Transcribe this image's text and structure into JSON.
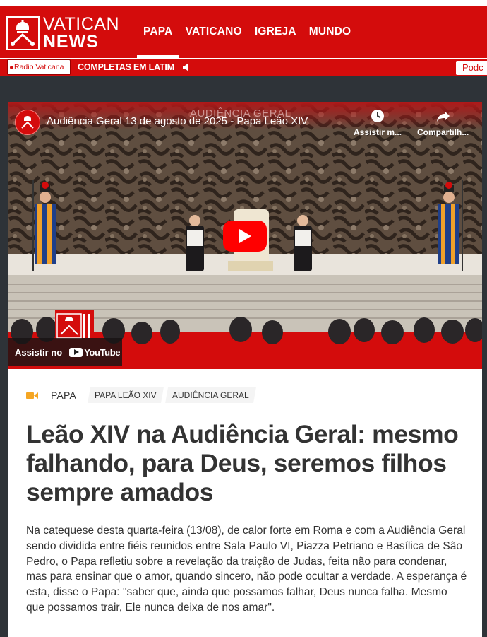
{
  "site": {
    "logo_line1": "VATICAN",
    "logo_line2": "NEWS"
  },
  "nav": {
    "items": [
      {
        "label": "PAPA",
        "active": true
      },
      {
        "label": "VATICANO"
      },
      {
        "label": "IGREJA"
      },
      {
        "label": "MUNDO"
      }
    ]
  },
  "radio": {
    "badge": "Radio Vaticana",
    "program": "COMPLETAS EM LATIM",
    "podcast_label": "Podc"
  },
  "video": {
    "title": "Audiência Geral 13 de agosto de 2025 - Papa Leão XIV",
    "watermark": "AUDIÊNCIA GERAL",
    "watch_later": "Assistir m...",
    "share": "Compartilh...",
    "watch_on": "Assistir no",
    "youtube": "YouTube"
  },
  "article": {
    "category": "PAPA",
    "tags": [
      "PAPA LEÃO XIV",
      "AUDIÊNCIA GERAL"
    ],
    "headline": "Leão XIV na Audiência Geral: mesmo falhando, para Deus, seremos filhos sempre amados",
    "lead": "Na catequese desta quarta-feira (13/08), de calor forte em Roma e com a Audiência Geral sendo dividida entre fiéis reunidos entre Sala Paulo VI, Piazza Petriano e Basílica de São Pedro, o Papa refletiu sobre a revelação da traição de Judas, feita não para condenar, mas para ensinar que o amor, quando sincero, não pode ocultar a verdade. A esperança é esta, disse o Papa: \"saber que, ainda que possamos falhar, Deus nunca falha. Mesmo que possamos trair, Ele nunca deixa de nos amar\"."
  },
  "colors": {
    "brand_red": "#d40c0c",
    "page_bg": "#2e3338",
    "camera_orange": "#f5a623",
    "youtube_red": "#ff0000"
  },
  "icons": [
    "vatican-emblem-icon",
    "speaker-icon",
    "clock-icon",
    "share-icon",
    "play-icon",
    "youtube-icon",
    "video-camera-icon"
  ]
}
